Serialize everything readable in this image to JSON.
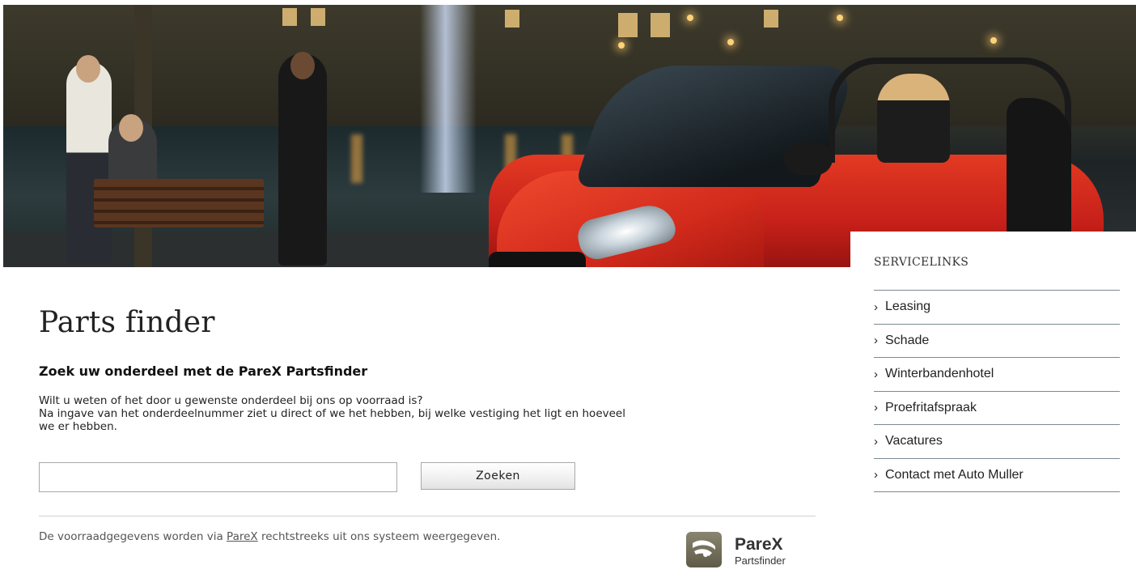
{
  "content": {
    "page_title": "Parts finder",
    "subtitle": "Zoek uw onderdeel met de PareX Partsfinder",
    "intro_line1": "Wilt u weten of het door u gewenste onderdeel bij ons op voorraad is?",
    "intro_line2": "Na ingave van het onderdeelnummer ziet u direct of we het hebben, bij welke vestiging het ligt en hoeveel",
    "intro_line3": "we er hebben.",
    "search": {
      "value": "",
      "placeholder": "",
      "button_label": "Zoeken"
    },
    "footer": {
      "text_before": "De voorraadgegevens worden via ",
      "link": "PareX",
      "text_after": " rechtstreeks uit ons systeem weergegeven."
    }
  },
  "logo": {
    "brand": "PareX",
    "sub": "Partsfinder"
  },
  "servicelinks": {
    "heading": "SERVICELINKS",
    "items": [
      {
        "label": "Leasing"
      },
      {
        "label": "Schade"
      },
      {
        "label": "Winterbandenhotel"
      },
      {
        "label": "Proefritafspraak"
      },
      {
        "label": "Vacatures"
      },
      {
        "label": "Contact met Auto Muller"
      }
    ]
  },
  "icons": {
    "chevron": "chevron-right-icon",
    "logo": "parex-logo-icon"
  },
  "colors": {
    "car_red": "#d22a1c",
    "divider": "#7b8a95",
    "text": "#222222"
  }
}
